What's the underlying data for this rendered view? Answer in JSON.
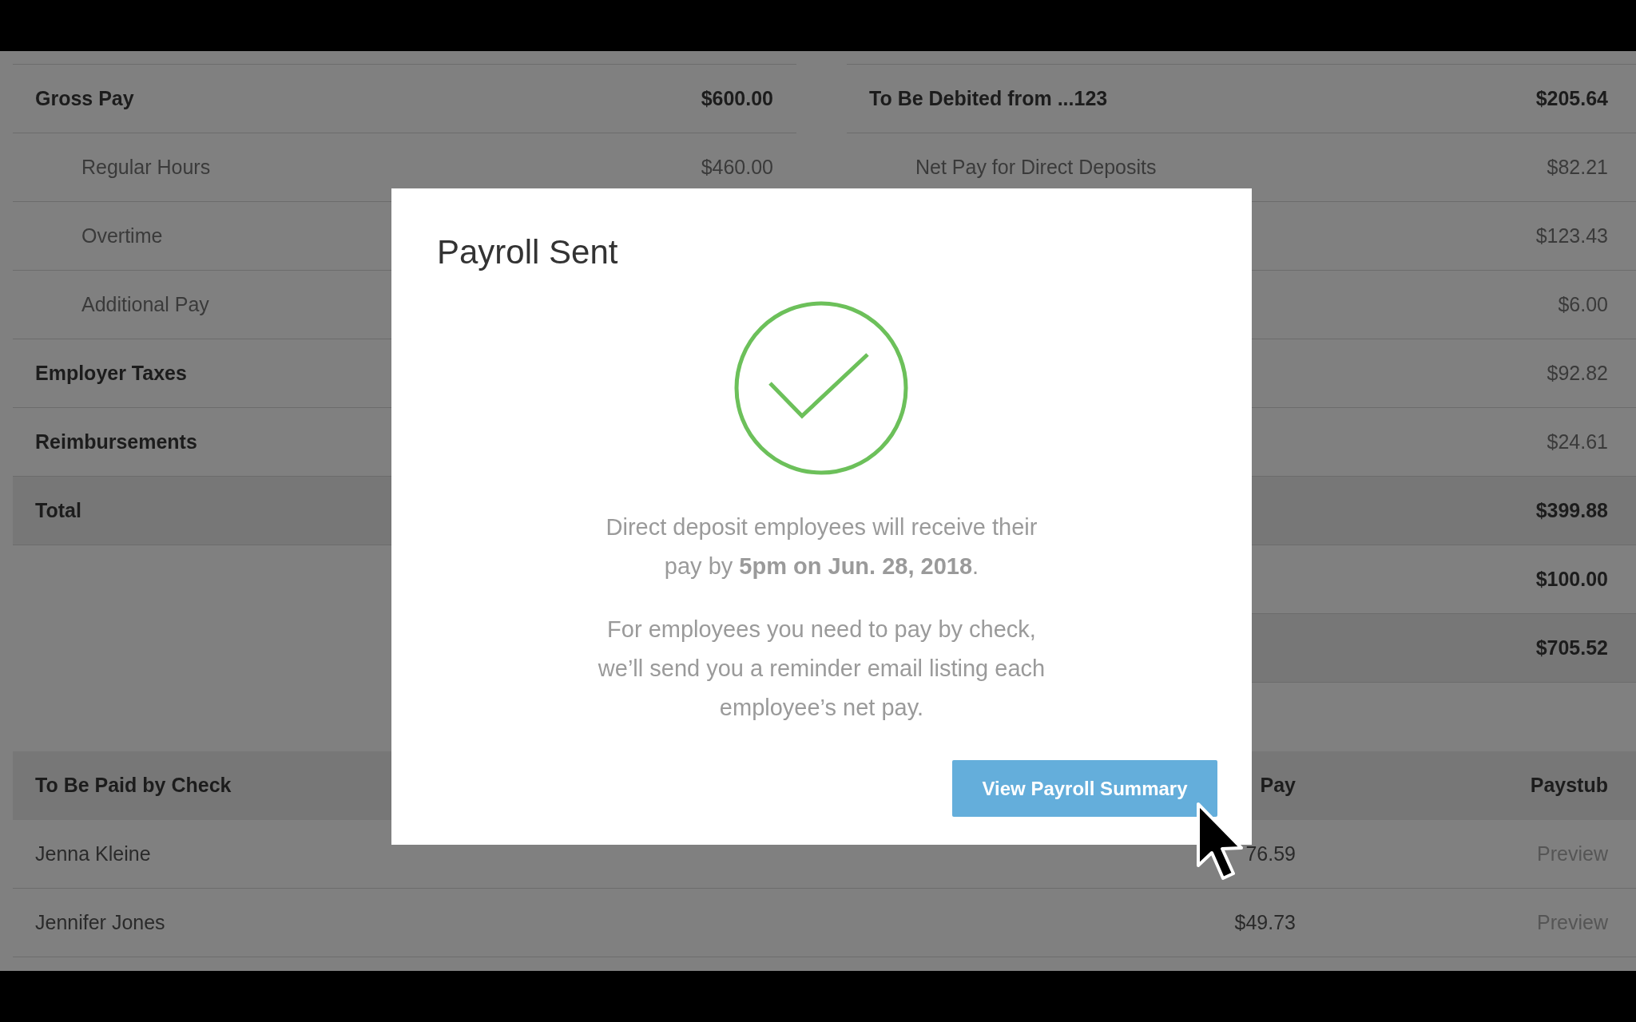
{
  "left_table": {
    "rows": [
      {
        "kind": "heading",
        "label": "Gross Pay",
        "amount": "$600.00"
      },
      {
        "kind": "sub",
        "label": "Regular Hours",
        "amount": "$460.00"
      },
      {
        "kind": "sub",
        "label": "Overtime"
      },
      {
        "kind": "sub",
        "label": "Additional Pay"
      },
      {
        "kind": "heading",
        "label": "Employer Taxes"
      },
      {
        "kind": "heading",
        "label": "Reimbursements"
      },
      {
        "kind": "total",
        "label": "Total"
      }
    ]
  },
  "right_table": {
    "rows": [
      {
        "kind": "heading",
        "label": "To Be Debited from ...123",
        "amount": "$205.64"
      },
      {
        "kind": "sub",
        "label": "Net Pay for Direct Deposits",
        "amount": "$82.21"
      },
      {
        "kind": "sub",
        "amount": "$123.43"
      },
      {
        "kind": "sub",
        "amount": "$6.00"
      },
      {
        "kind": "sub",
        "amount": "$92.82"
      },
      {
        "kind": "sub",
        "amount": "$24.61"
      },
      {
        "kind": "total",
        "amount": "$399.88"
      },
      {
        "kind": "heading",
        "amount": "$100.00"
      },
      {
        "kind": "total",
        "amount": "$705.52"
      }
    ]
  },
  "check_table": {
    "columns": [
      "To Be Paid by Check",
      "Pay",
      "Paystub"
    ],
    "rows": [
      {
        "name": "Jenna Kleine",
        "pay": "76.59",
        "paystub": "Preview"
      },
      {
        "name": "Jennifer Jones",
        "pay": "$49.73",
        "paystub": "Preview"
      }
    ]
  },
  "dialog": {
    "title": "Payroll Sent",
    "paragraphs": [
      "Direct deposit employees will receive their\npay by **5pm on Jun. 28, 2018**.",
      "For employees you need to pay by check,\nwe’ll send you a reminder email listing each\nemployee’s net pay."
    ],
    "button": "View Payroll Summary"
  }
}
